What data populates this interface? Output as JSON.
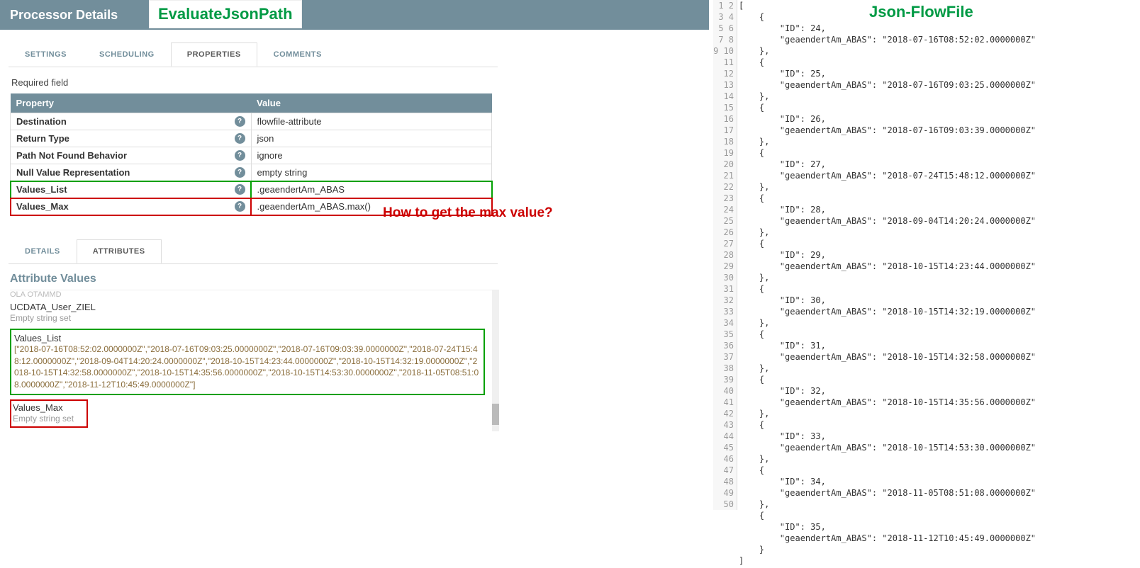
{
  "header": {
    "title": "Processor Details"
  },
  "overlay_label": "EvaluateJsonPath",
  "tabs_top": [
    "SETTINGS",
    "SCHEDULING",
    "PROPERTIES",
    "COMMENTS"
  ],
  "required_label": "Required field",
  "prop_header": {
    "c1": "Property",
    "c2": "Value"
  },
  "props": [
    {
      "name": "Destination",
      "val": "flowfile-attribute"
    },
    {
      "name": "Return Type",
      "val": "json"
    },
    {
      "name": "Path Not Found Behavior",
      "val": "ignore"
    },
    {
      "name": "Null Value Representation",
      "val": "empty string"
    },
    {
      "name": "Values_List",
      "val": ".geaendertAm_ABAS"
    },
    {
      "name": "Values_Max",
      "val": ".geaendertAm_ABAS.max()"
    }
  ],
  "annotation_question": "How to get the max value?",
  "tabs_bottom": [
    "DETAILS",
    "ATTRIBUTES"
  ],
  "section_title": "Attribute Values",
  "attrs": {
    "cut": "OLA OTAMMD",
    "a1_name": "UCDATA_User_ZIEL",
    "a1_val": "Empty string set",
    "a2_name": "Values_List",
    "a2_val": "[\"2018-07-16T08:52:02.0000000Z\",\"2018-07-16T09:03:25.0000000Z\",\"2018-07-16T09:03:39.0000000Z\",\"2018-07-24T15:48:12.0000000Z\",\"2018-09-04T14:20:24.0000000Z\",\"2018-10-15T14:23:44.0000000Z\",\"2018-10-15T14:32:19.0000000Z\",\"2018-10-15T14:32:58.0000000Z\",\"2018-10-15T14:35:56.0000000Z\",\"2018-10-15T14:53:30.0000000Z\",\"2018-11-05T08:51:08.0000000Z\",\"2018-11-12T10:45:49.0000000Z\"]",
    "a3_name": "Values_Max",
    "a3_val": "Empty string set"
  },
  "right_title": "Json-FlowFile",
  "chart_data": {
    "type": "table",
    "records": [
      {
        "ID": 24,
        "geaendertAm_ABAS": "2018-07-16T08:52:02.0000000Z"
      },
      {
        "ID": 25,
        "geaendertAm_ABAS": "2018-07-16T09:03:25.0000000Z"
      },
      {
        "ID": 26,
        "geaendertAm_ABAS": "2018-07-16T09:03:39.0000000Z"
      },
      {
        "ID": 27,
        "geaendertAm_ABAS": "2018-07-24T15:48:12.0000000Z"
      },
      {
        "ID": 28,
        "geaendertAm_ABAS": "2018-09-04T14:20:24.0000000Z"
      },
      {
        "ID": 29,
        "geaendertAm_ABAS": "2018-10-15T14:23:44.0000000Z"
      },
      {
        "ID": 30,
        "geaendertAm_ABAS": "2018-10-15T14:32:19.0000000Z"
      },
      {
        "ID": 31,
        "geaendertAm_ABAS": "2018-10-15T14:32:58.0000000Z"
      },
      {
        "ID": 32,
        "geaendertAm_ABAS": "2018-10-15T14:35:56.0000000Z"
      },
      {
        "ID": 33,
        "geaendertAm_ABAS": "2018-10-15T14:53:30.0000000Z"
      },
      {
        "ID": 34,
        "geaendertAm_ABAS": "2018-11-05T08:51:08.0000000Z"
      },
      {
        "ID": 35,
        "geaendertAm_ABAS": "2018-11-12T10:45:49.0000000Z"
      }
    ]
  }
}
